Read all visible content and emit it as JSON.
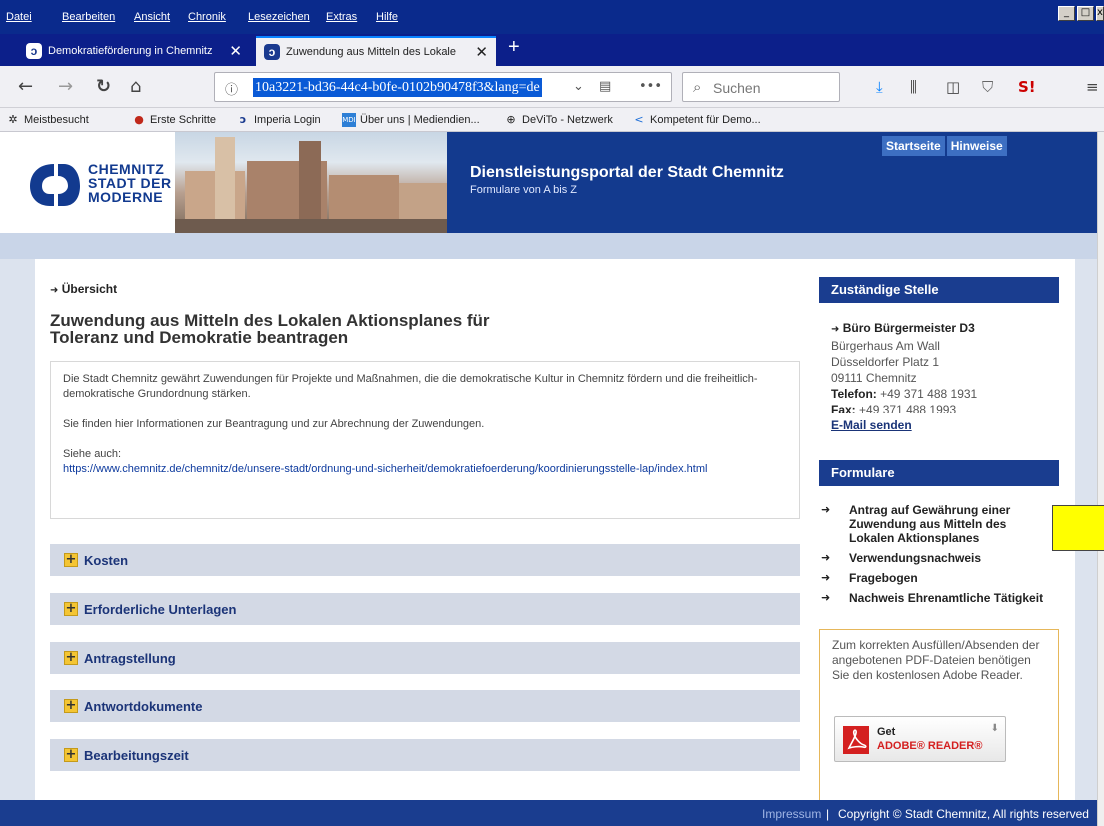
{
  "menubar": {
    "items": [
      "Datei",
      "Bearbeiten",
      "Ansicht",
      "Chronik",
      "Lesezeichen",
      "Extras",
      "Hilfe"
    ]
  },
  "tabs": [
    {
      "title": "Demokratieförderung in Chemnitz",
      "active": false
    },
    {
      "title": "Zuwendung aus Mitteln des Lokale",
      "active": true
    }
  ],
  "navbar": {
    "url": "10a3221-bd36-44c4-b0fe-0102b90478f3&lang=de",
    "search_placeholder": "Suchen"
  },
  "bookmarks": [
    {
      "label": "Meistbesucht",
      "icon": "gear-icon"
    },
    {
      "label": "Erste Schritte",
      "icon": "firefox-icon"
    },
    {
      "label": "Imperia Login",
      "icon": "chemnitz-icon"
    },
    {
      "label": "Über uns | Mediendien...",
      "icon": "mdr-icon"
    },
    {
      "label": "DeViTo - Netzwerk",
      "icon": "globe-icon"
    },
    {
      "label": "Kompetent für Demo...",
      "icon": "arrow-icon"
    }
  ],
  "site": {
    "logo_lines": [
      "CHEMNITZ",
      "STADT DER",
      "MODERNE"
    ],
    "title": "Dienstleistungsportal der Stadt Chemnitz",
    "subtitle": "Formulare von A bis Z",
    "topnav": [
      "Startseite",
      "Hinweise"
    ]
  },
  "main": {
    "breadcrumb": "Übersicht",
    "title_line1": "Zuwendung aus Mitteln des Lokalen Aktionsplanes für",
    "title_line2": "Toleranz und Demokratie beantragen",
    "intro_p1": "Die Stadt Chemnitz gewährt Zuwendungen für Projekte und Maßnahmen, die die demokratische Kultur in Chemnitz fördern und die freiheitlich-demokratische Grundordnung stärken.",
    "intro_p2": "Sie finden hier Informationen zur Beantragung und zur Abrechnung der Zuwendungen.",
    "see_also_label": "Siehe auch:",
    "see_also_link": "https://www.chemnitz.de/chemnitz/de/unsere-stadt/ordnung-und-sicherheit/demokratiefoerderung/koordinierungsstelle-lap/index.html",
    "sections": [
      "Kosten",
      "Erforderliche Unterlagen",
      "Antragstellung",
      "Antwortdokumente",
      "Bearbeitungszeit"
    ]
  },
  "sidebar": {
    "contact_heading": "Zuständige Stelle",
    "office": "Büro Bürgermeister D3",
    "address1": "Bürgerhaus Am Wall",
    "address2": "Düsseldorfer Platz 1",
    "address3": "09111 Chemnitz",
    "phone_label": "Telefon:",
    "phone": "+49 371 488 1931",
    "fax_label": "Fax:",
    "fax": "+49 371 488 1993",
    "email_link": "E-Mail senden",
    "forms_heading": "Formulare",
    "forms": [
      "Antrag auf Gewährung einer Zuwendung aus Mitteln des Lokalen Aktionsplanes",
      "Verwendungsnachweis",
      "Fragebogen",
      "Nachweis Ehrenamtliche Tätigkeit"
    ],
    "adobe_text": "Zum korrekten Ausfüllen/Absenden der angebotenen PDF-Dateien benötigen Sie den kostenlosen Adobe Reader.",
    "adobe_get": "Get",
    "adobe_reader": "ADOBE® READER®"
  },
  "footer": {
    "impressum": "Impressum",
    "separator": "|",
    "copyright": "Copyright © Stadt Chemnitz, All rights reserved"
  },
  "colors": {
    "brand_blue": "#133a8e",
    "accordion_bg": "#d3d9e5",
    "accent_yellow": "#f4c533"
  }
}
